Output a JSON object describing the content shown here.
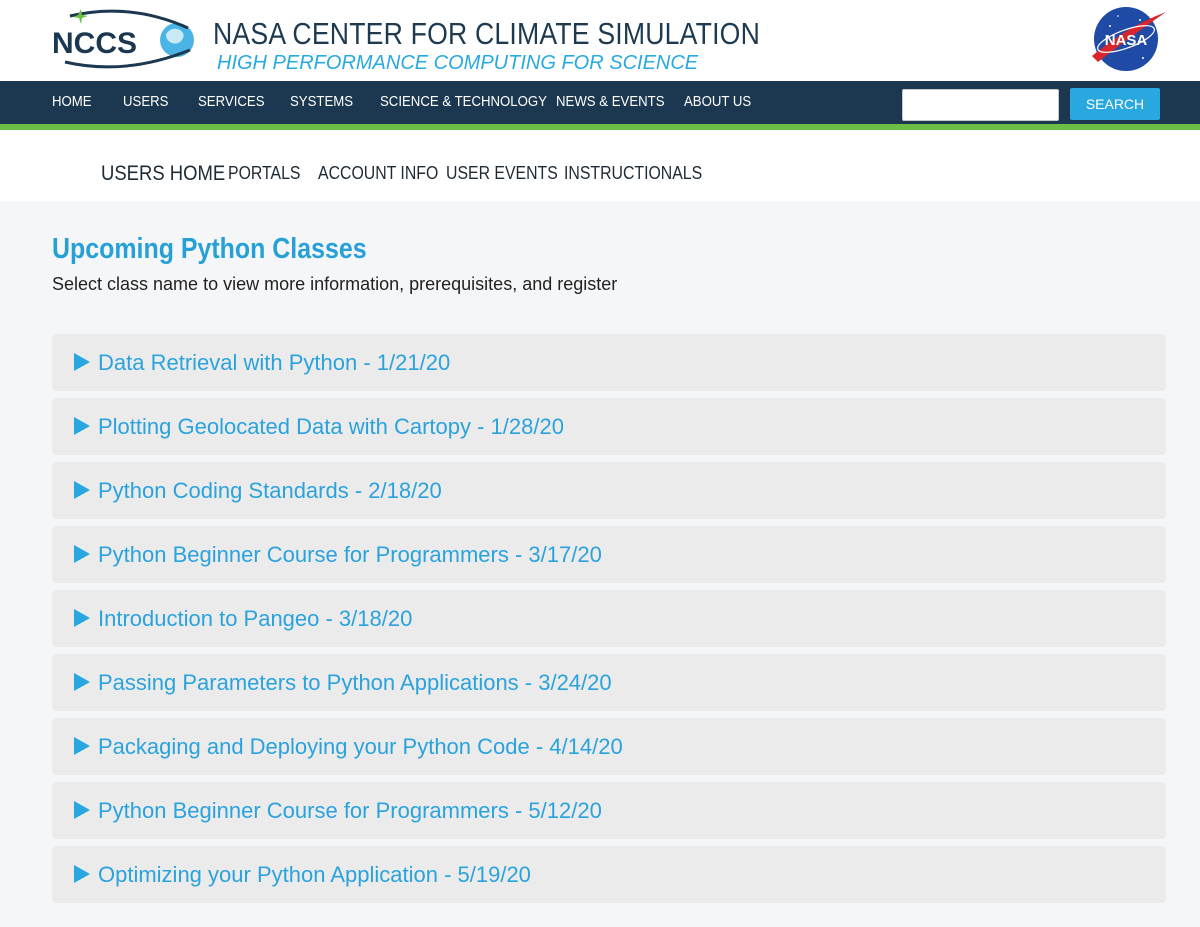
{
  "header": {
    "logo_text": "NCCS",
    "title": "NASA CENTER FOR CLIMATE SIMULATION",
    "tagline": "HIGH PERFORMANCE COMPUTING FOR SCIENCE",
    "nasa_logo_text": "NASA"
  },
  "main_nav": {
    "items": [
      {
        "label": "HOME"
      },
      {
        "label": "USERS"
      },
      {
        "label": "SERVICES"
      },
      {
        "label": "SYSTEMS"
      },
      {
        "label": "SCIENCE & TECHNOLOGY"
      },
      {
        "label": "NEWS & EVENTS"
      },
      {
        "label": "ABOUT US"
      }
    ],
    "search_value": "",
    "search_button": "SEARCH"
  },
  "sub_nav": {
    "items": [
      {
        "label": "USERS HOME"
      },
      {
        "label": "PORTALS"
      },
      {
        "label": "ACCOUNT INFO"
      },
      {
        "label": "USER EVENTS"
      },
      {
        "label": "INSTRUCTIONALS"
      }
    ]
  },
  "content": {
    "title": "Upcoming Python Classes",
    "subtitle": "Select class name to view more information, prerequisites, and register",
    "classes": [
      {
        "label": "Data Retrieval with Python - 1/21/20"
      },
      {
        "label": "Plotting Geolocated Data with Cartopy - 1/28/20"
      },
      {
        "label": "Python Coding Standards - 2/18/20"
      },
      {
        "label": "Python Beginner Course for Programmers - 3/17/20"
      },
      {
        "label": "Introduction to Pangeo - 3/18/20"
      },
      {
        "label": "Passing Parameters to Python Applications - 3/24/20"
      },
      {
        "label": "Packaging and Deploying your Python Code - 4/14/20"
      },
      {
        "label": "Python Beginner Course for Programmers - 5/12/20"
      },
      {
        "label": "Optimizing your Python Application - 5/19/20"
      }
    ]
  },
  "colors": {
    "nav_bg": "#1b3850",
    "accent_green": "#6cbe45",
    "accent_blue": "#29a8e0",
    "item_bg": "#ebebeb"
  }
}
